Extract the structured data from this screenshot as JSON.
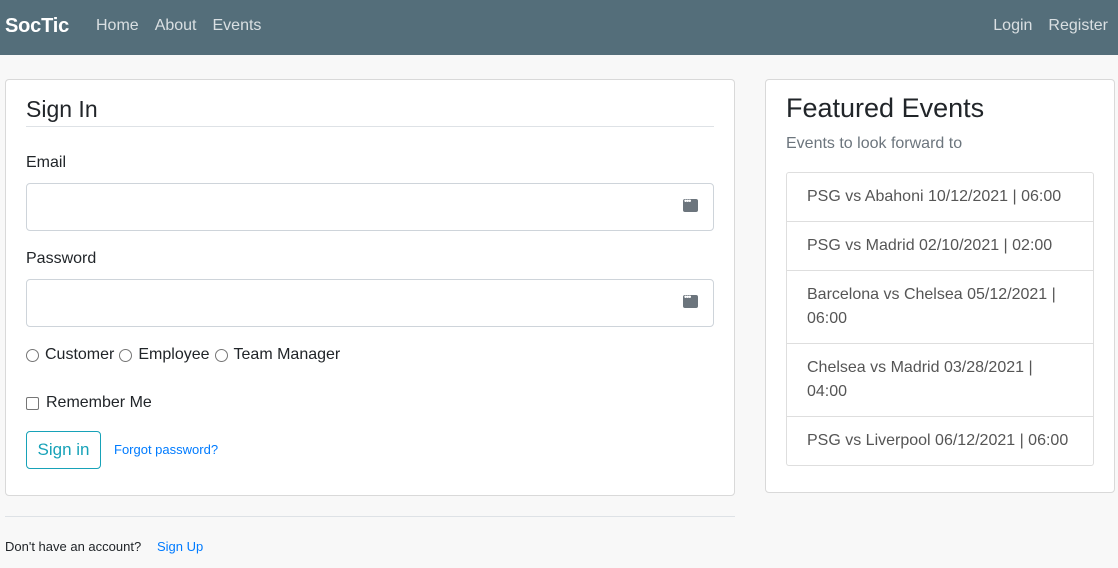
{
  "navbar": {
    "brand": "SocTic",
    "left_links": [
      "Home",
      "About",
      "Events"
    ],
    "right_links": [
      "Login",
      "Register"
    ]
  },
  "signin": {
    "title": "Sign In",
    "email_label": "Email",
    "email_value": "",
    "password_label": "Password",
    "password_value": "",
    "roles": [
      "Customer",
      "Employee",
      "Team Manager"
    ],
    "remember_label": "Remember Me",
    "submit_label": "Sign in",
    "forgot_label": "Forgot password?"
  },
  "footer": {
    "prompt": "Don't have an account?",
    "signup_label": "Sign Up"
  },
  "featured": {
    "title": "Featured Events",
    "subtitle": "Events to look forward to",
    "events": [
      "PSG vs Abahoni 10/12/2021 | 06:00",
      "PSG vs Madrid 02/10/2021 | 02:00",
      "Barcelona vs Chelsea 05/12/2021 | 06:00",
      "Chelsea vs Madrid 03/28/2021 | 04:00",
      "PSG vs Liverpool 06/12/2021 | 06:00"
    ]
  },
  "colors": {
    "navbar": "#546e7a",
    "accent": "#17a2b8",
    "link": "#007bff"
  }
}
